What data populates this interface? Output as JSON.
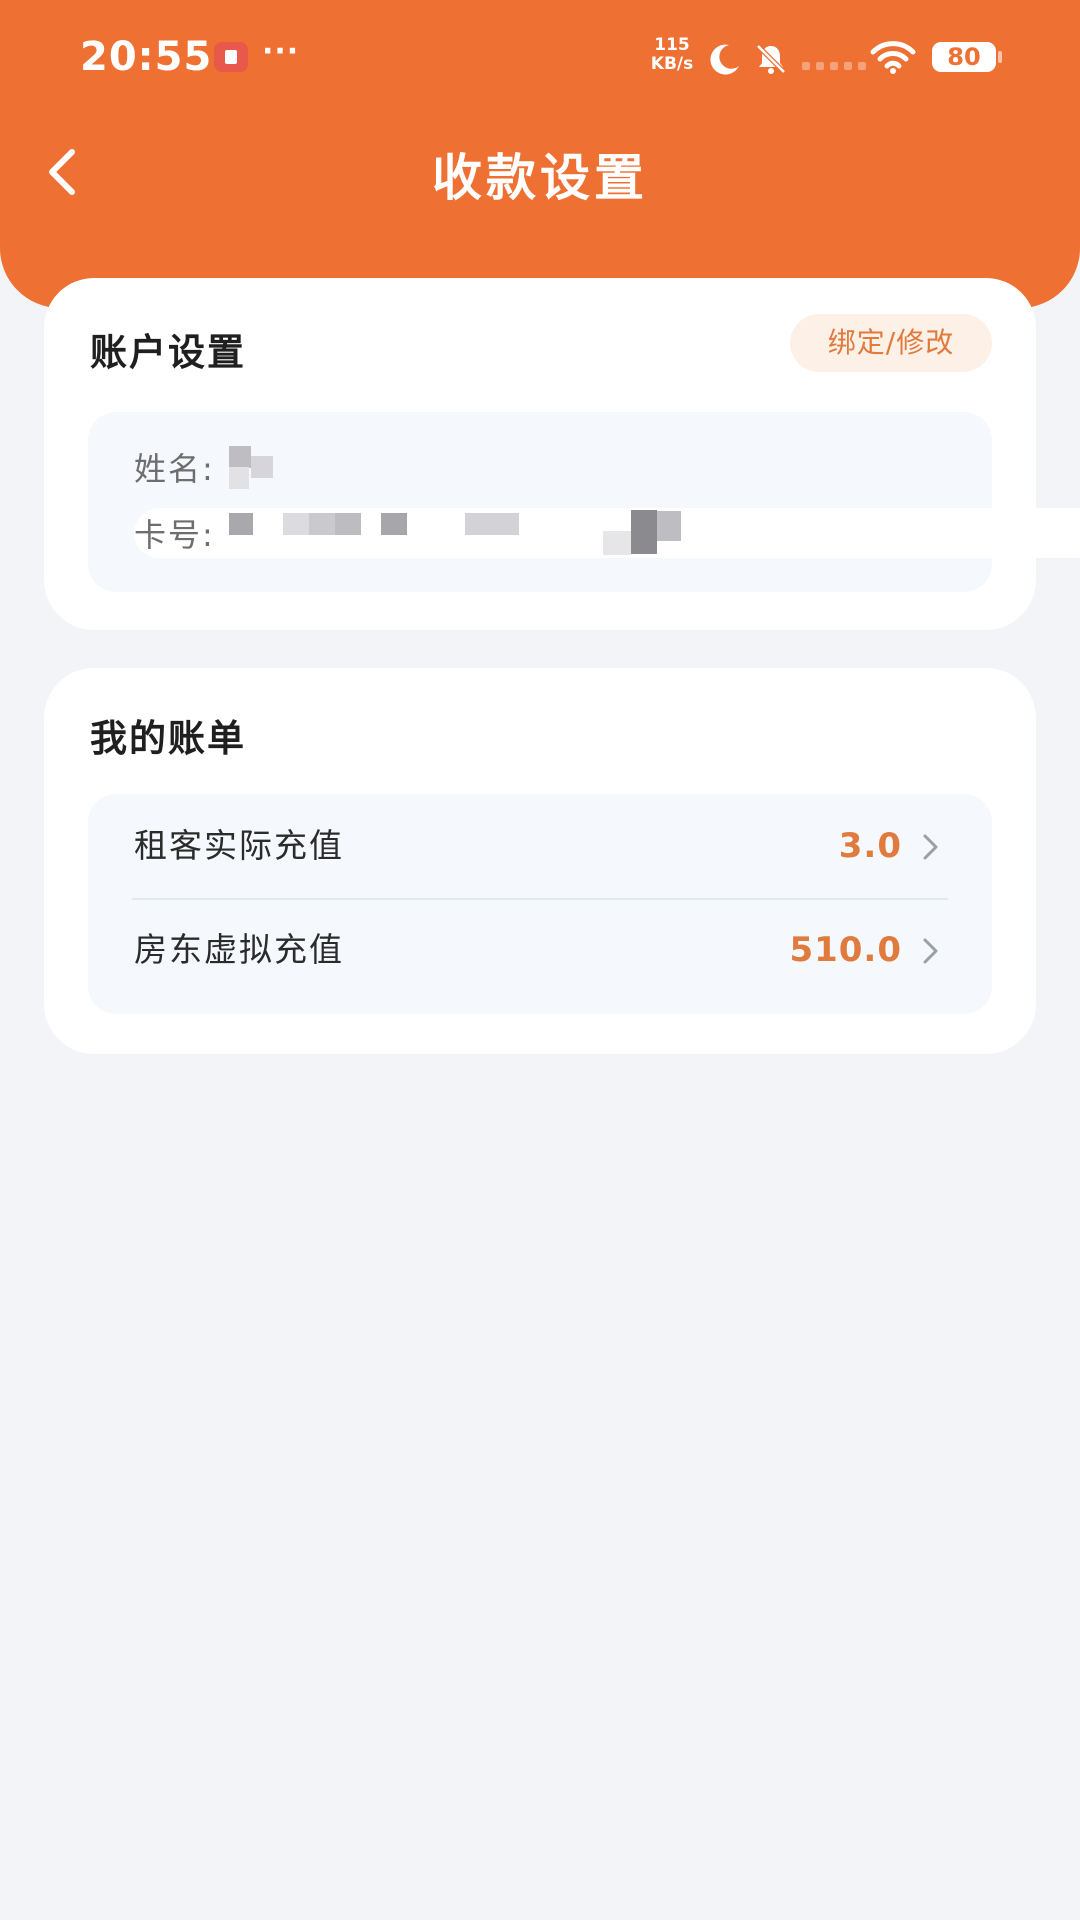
{
  "status_bar": {
    "time": "20:55",
    "more": "···",
    "net_speed_value": "115",
    "net_speed_unit": "KB/s",
    "battery": "80"
  },
  "nav": {
    "title": "收款设置"
  },
  "account_card": {
    "title": "账户设置",
    "bind_button": "绑定/修改",
    "name_label": "姓名:",
    "card_label": "卡号:"
  },
  "bill_card": {
    "title": "我的账单",
    "rows": [
      {
        "label": "租客实际充值",
        "value": "3.0"
      },
      {
        "label": "房东虚拟充值",
        "value": "510.0"
      }
    ]
  },
  "colors": {
    "header": "#ee7033",
    "accent_text": "#e07a3d",
    "bind_button_bg": "#fdf0e6",
    "page_bg": "#f2f4f8"
  }
}
